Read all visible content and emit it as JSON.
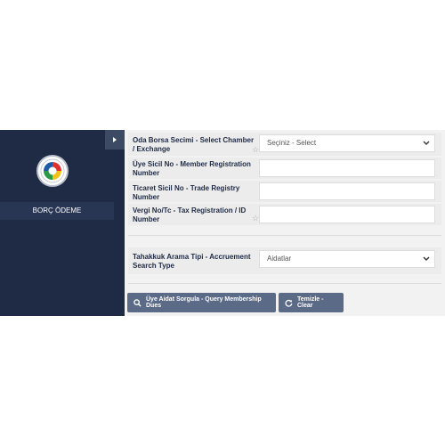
{
  "sidebar": {
    "menu_item": "BORÇ ÖDEME"
  },
  "form": {
    "chamber": {
      "label": "Oda Borsa Secimi - Select Chamber / Exchange",
      "value": "Seçiniz - Select"
    },
    "member_no": {
      "label": "Üye Sicil No - Member Registration Number",
      "value": ""
    },
    "trade_registry": {
      "label": "Ticaret Sicil No - Trade Registry Number",
      "value": ""
    },
    "tax_no": {
      "label": "Vergi No/Tc - Tax Registration / ID Number",
      "value": ""
    },
    "accruement": {
      "label": "Tahakkuk Arama Tipi - Accruement Search Type",
      "value": "Aidatlar"
    }
  },
  "buttons": {
    "query": "Üye Aidat Sorgula - Query Membership Dues",
    "clear": "Temizle - Clear"
  },
  "colors": {
    "sidebar": "#1f2a44",
    "button": "#5b6b87",
    "panel": "#f2f2f2"
  }
}
